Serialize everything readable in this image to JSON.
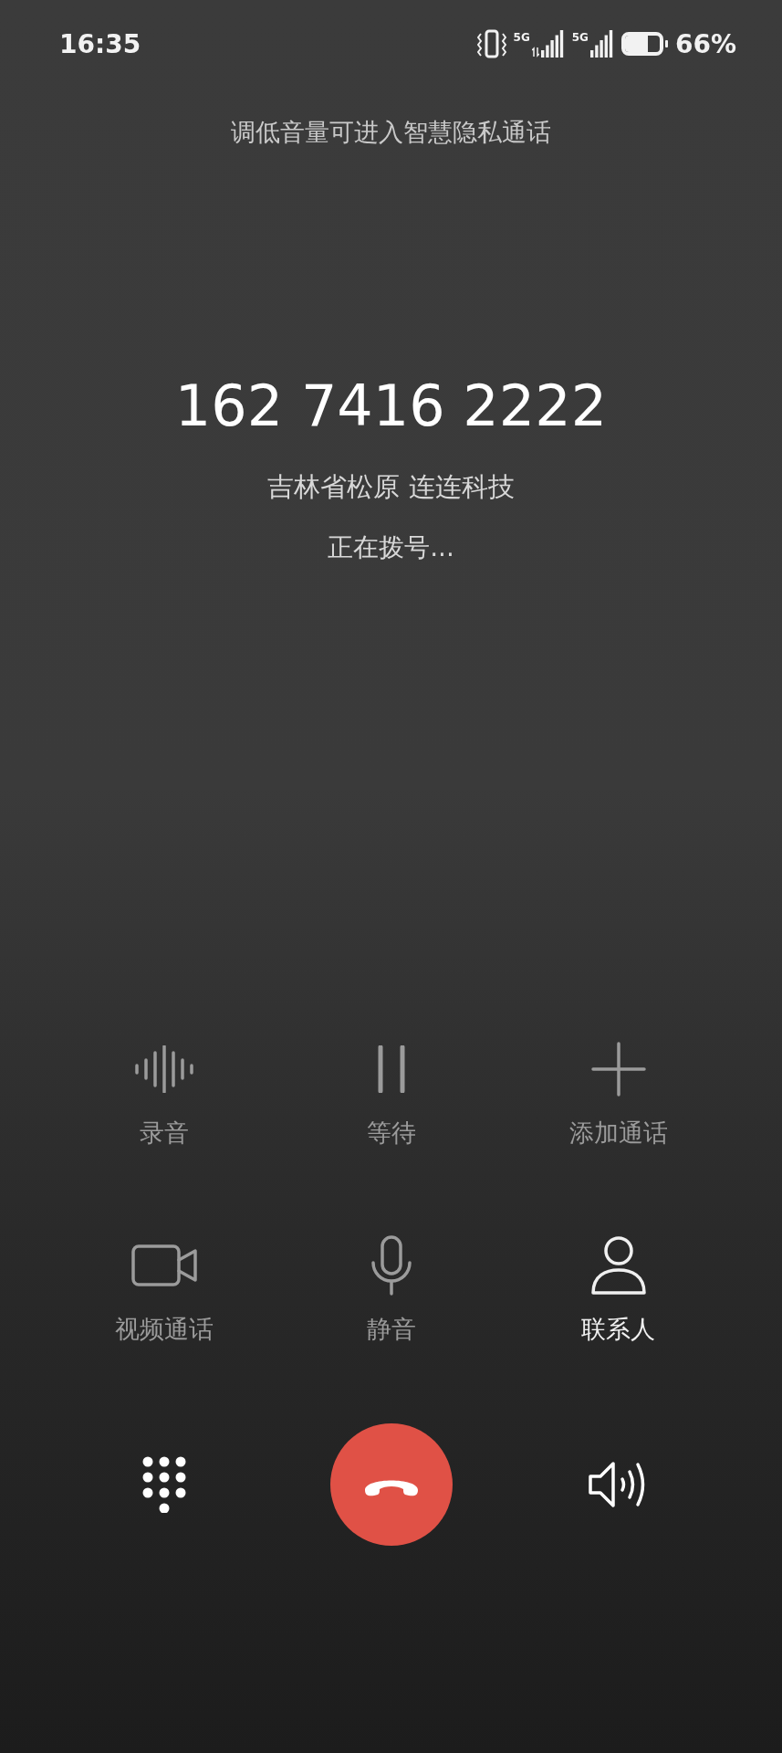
{
  "status_bar": {
    "time": "16:35",
    "signals": [
      {
        "network": "5G",
        "data_arrows": true
      },
      {
        "network": "5G",
        "data_arrows": false
      }
    ],
    "battery": {
      "level": 0.66,
      "percent": "66%"
    }
  },
  "hint": "调低音量可进入智慧隐私通话",
  "call": {
    "number": "162 7416 2222",
    "location": "吉林省松原 连连科技",
    "status": "正在拨号..."
  },
  "actions": [
    {
      "kind": "record",
      "label": "录音",
      "disabled": true
    },
    {
      "kind": "hold",
      "label": "等待",
      "disabled": true
    },
    {
      "kind": "add",
      "label": "添加通话",
      "disabled": true
    },
    {
      "kind": "video",
      "label": "视频通话",
      "disabled": true
    },
    {
      "kind": "mute",
      "label": "静音",
      "disabled": true
    },
    {
      "kind": "contact",
      "label": "联系人",
      "disabled": false
    }
  ],
  "bottom_controls": [
    {
      "kind": "dialpad"
    },
    {
      "kind": "end_call"
    },
    {
      "kind": "speaker"
    }
  ]
}
